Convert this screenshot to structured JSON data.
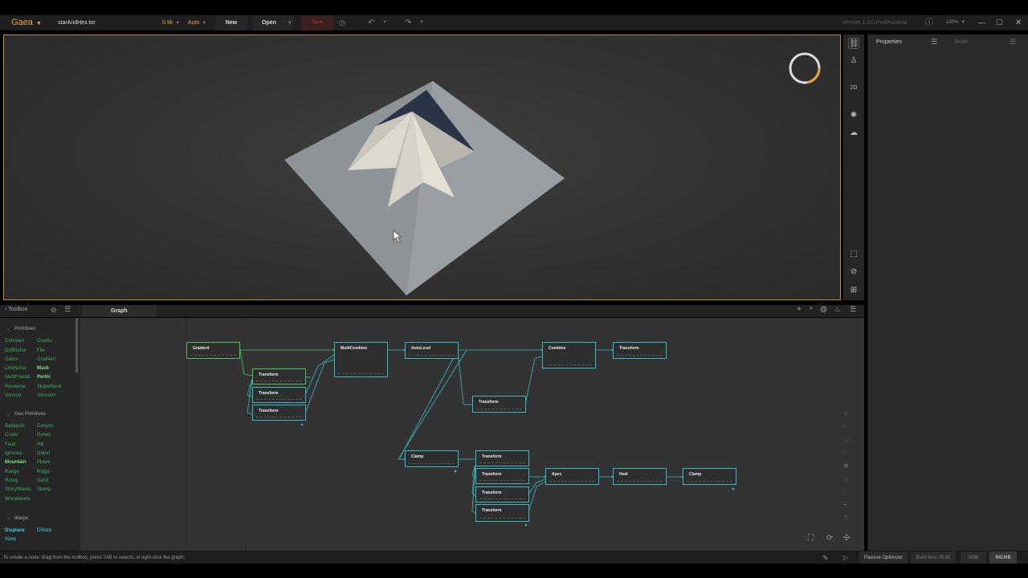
{
  "titlebar": {
    "brand": "Gaea",
    "filename": "starAndHex.tor",
    "resolution": "0.5k",
    "auto": "Auto",
    "new_label": "New",
    "open_label": "Open",
    "save_label": "Save",
    "version": "Version 1.3.0 Professional",
    "zoom": "100%"
  },
  "properties": {
    "title": "Properties",
    "build_tab": "Build"
  },
  "toolbox": {
    "title": "Toolbox",
    "sections": [
      {
        "name": "Primitives",
        "items": [
          "Constant",
          "Cracks",
          "DriftNoise",
          "File",
          "Gabor",
          "Gradient",
          "LineNoise",
          "Mask",
          "MultiFractal",
          "Perlin",
          "Resource",
          "SlopeNoise",
          "Voronoi",
          "Voronoi+"
        ]
      },
      {
        "name": "Geo Primitives",
        "items": [
          "Badlands",
          "Canyon",
          "Crater",
          "Dunes",
          "Fault",
          "Hill",
          "Igneous",
          "Island",
          "Mountain",
          "Plates",
          "Range",
          "Ridge",
          "Rocky",
          "Sand",
          "ShinyWaves",
          "Slump",
          "Worselands"
        ]
      },
      {
        "name": "Warps",
        "items": [
          "Displace",
          "DWarp",
          "Warp"
        ]
      }
    ]
  },
  "graph": {
    "tab": "Graph",
    "nodes": {
      "gradient": "Gradient",
      "multicombine": "MultiCombine",
      "autolevel": "AutoLevel",
      "combine": "Combine",
      "transform": "Transform",
      "clamp": "Clamp",
      "apex": "Apex",
      "heal": "Heal"
    }
  },
  "status": {
    "hint": "To create a node: drag from the toolbox, press TAB to search, or right-click the graph.",
    "passive": "Passive Optimizer",
    "build_time": "Build time 00:00",
    "gb": "0GB",
    "memory": "941MB"
  },
  "colors": {
    "accent": "#e6a43a",
    "node_green": "#4fc25a",
    "node_cyan": "#35b9c6",
    "save_red": "#c54040"
  }
}
